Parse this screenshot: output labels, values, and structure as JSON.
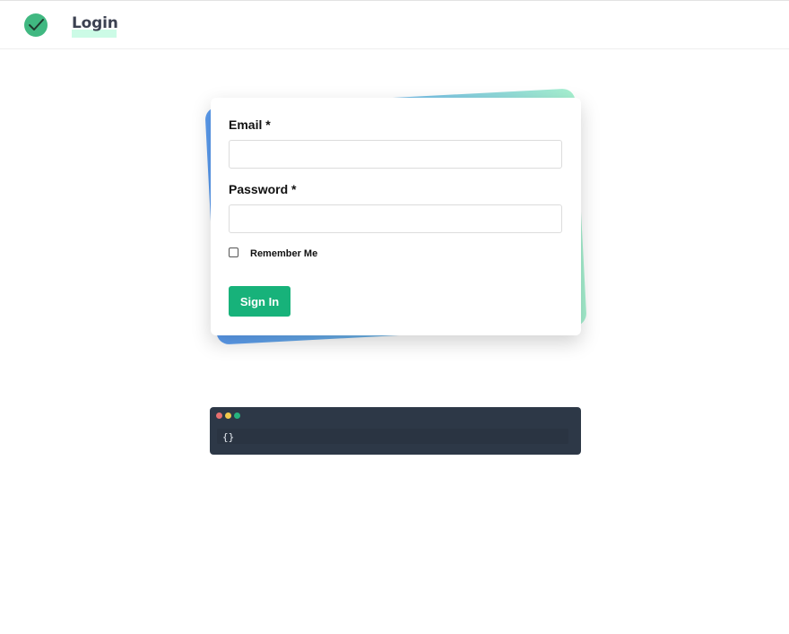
{
  "header": {
    "logo_icon": "check-circle-icon",
    "title": "Login"
  },
  "form": {
    "email_label": "Email *",
    "email_value": "",
    "password_label": "Password *",
    "password_value": "",
    "remember_label": "Remember Me",
    "remember_checked": false,
    "submit_label": "Sign In"
  },
  "code_panel": {
    "content": "{}"
  },
  "colors": {
    "brand_green": "#17b27a",
    "logo_green": "#40b881",
    "title_text": "#3c4151",
    "title_highlight": "#ccfbe6",
    "card_gradient_start": "#5b9cf0",
    "card_gradient_end": "#a6f0cf",
    "code_bg": "#2d3847"
  }
}
